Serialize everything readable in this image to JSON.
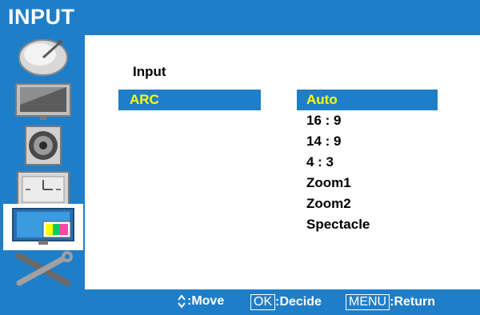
{
  "header": {
    "title": "INPUT"
  },
  "sidebar": {
    "items": [
      {
        "icon": "satellite-dish-icon"
      },
      {
        "icon": "tv-monitor-icon"
      },
      {
        "icon": "speaker-icon"
      },
      {
        "icon": "clock-panel-icon"
      },
      {
        "icon": "input-screen-icon",
        "selected": true
      },
      {
        "icon": "tools-icon"
      }
    ]
  },
  "main": {
    "input_label": "Input",
    "arc_label": "ARC",
    "options": [
      "Auto",
      "16 : 9",
      "14 : 9",
      "4 : 3",
      "Zoom1",
      "Zoom2",
      "Spectacle"
    ],
    "selected_option": "Auto"
  },
  "footer": {
    "move_label": ":Move",
    "ok_key": "OK",
    "decide_label": ":Decide",
    "menu_key": "MENU",
    "return_label": ":Return"
  },
  "colors": {
    "accent": "#1f7ec8",
    "highlight_text": "#ffff00"
  }
}
